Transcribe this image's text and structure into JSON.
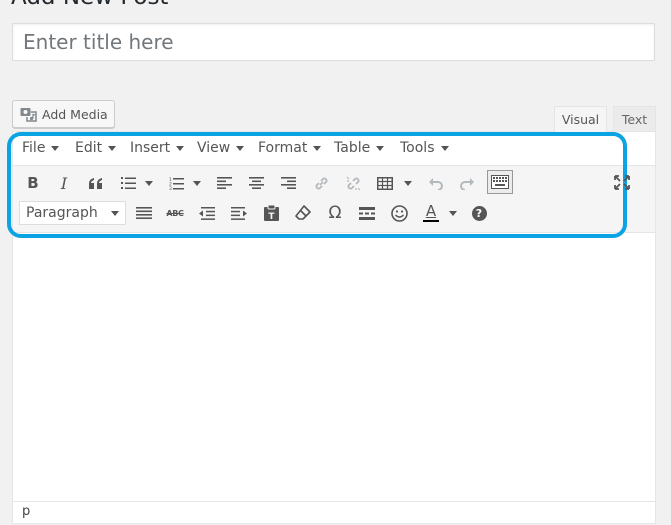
{
  "page": {
    "heading": "Add New Post"
  },
  "title_field": {
    "placeholder": "Enter title here",
    "value": ""
  },
  "media": {
    "add_media_label": "Add Media"
  },
  "editor_tabs": {
    "visual": "Visual",
    "text": "Text",
    "active": "Visual"
  },
  "menubar": {
    "items": [
      {
        "label": "File"
      },
      {
        "label": "Edit"
      },
      {
        "label": "Insert"
      },
      {
        "label": "View"
      },
      {
        "label": "Format"
      },
      {
        "label": "Table"
      },
      {
        "label": "Tools"
      }
    ]
  },
  "toolbar1": {
    "buttons": [
      "bold-icon",
      "italic-icon",
      "blockquote-icon",
      "bullet-list-icon",
      "numbered-list-icon",
      "align-left-icon",
      "align-center-icon",
      "align-right-icon",
      "link-icon",
      "unlink-icon",
      "table-icon",
      "undo-icon",
      "redo-icon",
      "kitchen-sink-icon",
      "fullscreen-icon"
    ]
  },
  "toolbar2": {
    "format_select": "Paragraph",
    "buttons": [
      "justify-icon",
      "strikethrough-icon",
      "outdent-icon",
      "indent-icon",
      "paste-text-icon",
      "clear-formatting-icon",
      "special-character-icon",
      "horizontal-rule-icon",
      "emoticons-icon",
      "text-color-icon",
      "help-icon"
    ],
    "strikethrough_glyph": "ABC",
    "omega_glyph": "Ω",
    "text_color_glyph": "A",
    "bold_glyph": "B",
    "italic_glyph": "I",
    "help_glyph": "?"
  },
  "statusbar": {
    "path": "p"
  },
  "colors": {
    "highlight": "#0aa3e3",
    "text_color_underline": "#000000"
  }
}
